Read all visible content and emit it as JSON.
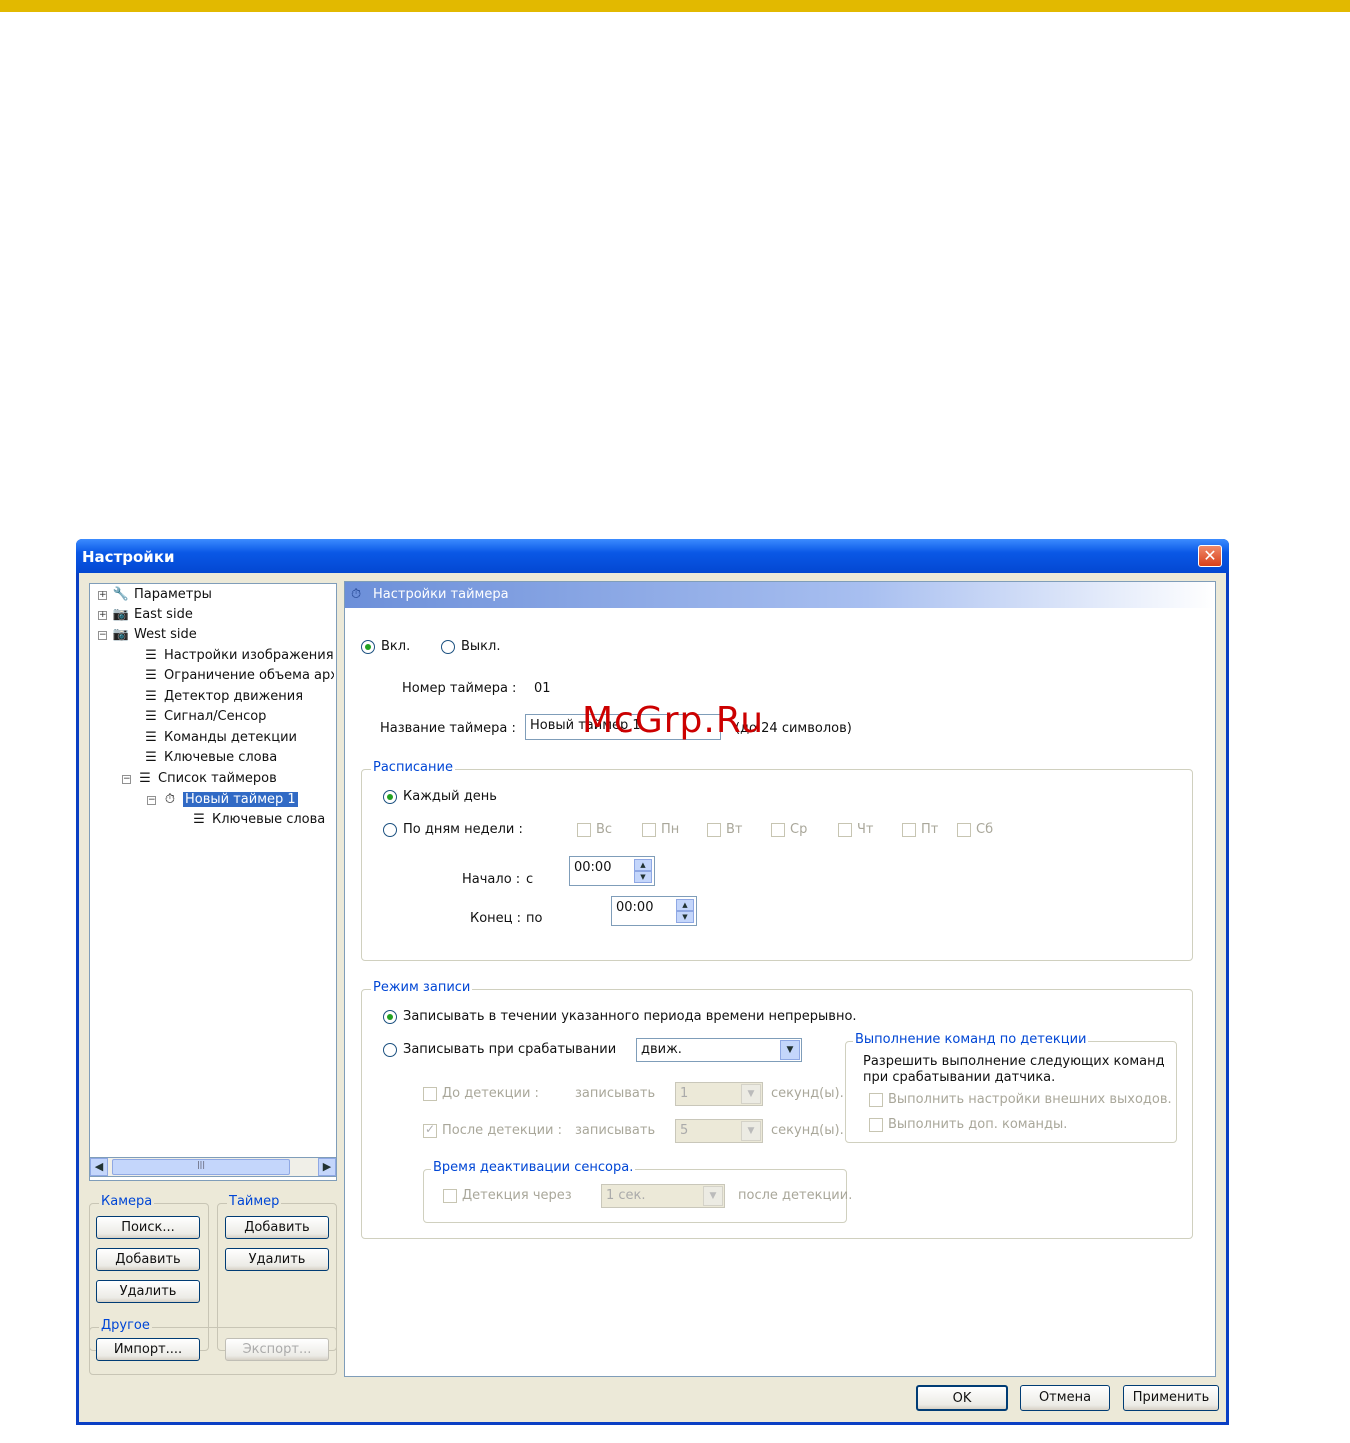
{
  "window": {
    "title": "Настройки",
    "close": "✕"
  },
  "tree": {
    "items": [
      {
        "label": "Параметры",
        "icon": "wrench-icon"
      },
      {
        "label": "East side",
        "icon": "camera-icon"
      },
      {
        "label": "West side",
        "icon": "camera-icon"
      },
      {
        "label": "Настройки изображения",
        "icon": "list-icon"
      },
      {
        "label": "Ограничение объема архи",
        "icon": "list-icon"
      },
      {
        "label": "Детектор движения",
        "icon": "list-icon"
      },
      {
        "label": "Сигнал/Сенсор",
        "icon": "list-icon"
      },
      {
        "label": "Команды детекции",
        "icon": "list-icon"
      },
      {
        "label": "Ключевые слова",
        "icon": "list-icon"
      },
      {
        "label": "Список таймеров",
        "icon": "list-icon"
      },
      {
        "label": "Новый таймер 1",
        "icon": "timer-icon"
      },
      {
        "label": "Ключевые слова",
        "icon": "list-icon"
      }
    ]
  },
  "camera_group": {
    "legend": "Камера",
    "search": "Поиск...",
    "add": "Добавить",
    "delete": "Удалить"
  },
  "timer_group": {
    "legend": "Таймер",
    "add": "Добавить",
    "delete": "Удалить"
  },
  "other_group": {
    "legend": "Другое",
    "import": "Импорт....",
    "export": "Экспорт..."
  },
  "panel": {
    "header": "Настройки таймера",
    "on": "Вкл.",
    "off": "Выкл.",
    "timer_number_label": "Номер таймера :",
    "timer_number": "01",
    "timer_name_label": "Название таймера :",
    "timer_name": "Новый таймер 1",
    "timer_name_hint": "(до 24 символов)",
    "schedule": {
      "legend": "Расписание",
      "every_day": "Каждый день",
      "by_weekdays": "По дням недели :",
      "days": [
        "Вс",
        "Пн",
        "Вт",
        "Ср",
        "Чт",
        "Пт",
        "Сб"
      ],
      "start_label": "Начало :",
      "start_from": "с",
      "start_value": "00:00",
      "end_label": "Конец :",
      "end_to": "по",
      "end_value": "00:00"
    },
    "record_mode": {
      "legend": "Режим записи",
      "continuous": "Записывать в течении указанного периода времени непрерывно.",
      "on_trigger": "Записывать при срабатывании",
      "trigger_value": "движ.",
      "pre_detection": "До детекции :",
      "record": "записывать",
      "pre_value": "1",
      "seconds": "секунд(ы).",
      "post_detection": "После детекции :",
      "post_value": "5",
      "sensor_deactivation": {
        "legend": "Время деактивации сенсора.",
        "detection_after": "Детекция через",
        "value": "1 сек.",
        "after_detection": "после детекции."
      },
      "commands": {
        "legend": "Выполнение команд по детекции",
        "allow_line1": "Разрешить выполнение следующих команд",
        "allow_line2": "при срабатывании датчика.",
        "external_outputs": "Выполнить настройки внешних выходов.",
        "extra_commands": "Выполнить доп. команды."
      }
    }
  },
  "footer": {
    "ok": "OK",
    "cancel": "Отмена",
    "apply": "Применить"
  },
  "watermark": "McGrp.Ru",
  "colors": {
    "accent": "#e2b900",
    "titlebar": "#0a58e6",
    "selection": "#316ac5",
    "legend": "#0046d5"
  }
}
